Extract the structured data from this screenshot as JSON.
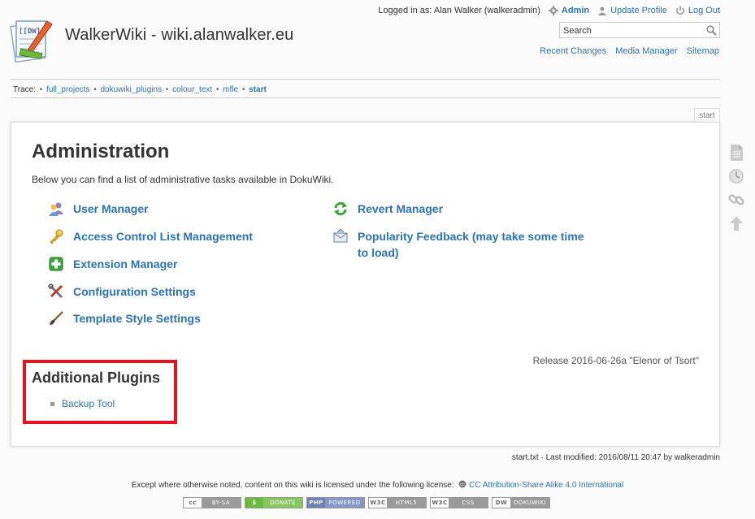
{
  "site": {
    "title": "WalkerWiki - wiki.alanwalker.eu",
    "logo_text": "[[DW]]"
  },
  "user_tools": {
    "logged_in_as": "Logged in as: Alan Walker (walkeradmin)",
    "admin": "Admin",
    "update_profile": "Update Profile",
    "logout": "Log Out"
  },
  "search": {
    "placeholder": "Search"
  },
  "site_tools": [
    "Recent Changes",
    "Media Manager",
    "Sitemap"
  ],
  "breadcrumbs": {
    "label": "Trace:",
    "items": [
      "full_projects",
      "dokuwiki_plugins",
      "colour_text",
      "mfle",
      "start"
    ]
  },
  "page_tab": "start",
  "main": {
    "heading": "Administration",
    "intro": "Below you can find a list of administrative tasks available in DokuWiki.",
    "admin_tasks_left": [
      {
        "label": "User Manager",
        "icon": "users-icon"
      },
      {
        "label": "Access Control List Management",
        "icon": "key-icon"
      },
      {
        "label": "Extension Manager",
        "icon": "plus-puzzle-icon"
      },
      {
        "label": "Configuration Settings",
        "icon": "tools-icon"
      },
      {
        "label": "Template Style Settings",
        "icon": "brush-icon"
      }
    ],
    "admin_tasks_right": [
      {
        "label": "Revert Manager",
        "icon": "revert-icon"
      },
      {
        "label": "Popularity Feedback (may take some time to load)",
        "icon": "envelope-icon"
      }
    ],
    "release": "Release 2016-06-26a \"Elenor of Tsort\"",
    "additional_plugins": {
      "heading": "Additional Plugins",
      "items": [
        "Backup Tool"
      ]
    }
  },
  "doc_info": "start.txt · Last modified: 2016/08/11 20:47 by walkeradmin",
  "license": {
    "prefix": "Except where otherwise noted, content on this wiki is licensed under the following license:",
    "link": "CC Attribution-Share Alike 4.0 International"
  },
  "badges": [
    {
      "left": "cc",
      "right": "BY-SA"
    },
    {
      "left": "$",
      "right": "DONATE"
    },
    {
      "left": "PHP",
      "right": "POWERED"
    },
    {
      "left": "W3C",
      "right": "HTML5"
    },
    {
      "left": "W3C",
      "right": "CSS"
    },
    {
      "left": "DW",
      "right": "DOKUWIKI"
    }
  ],
  "colors": {
    "link": "#2b73b7",
    "highlight_box": "#e8111f"
  }
}
